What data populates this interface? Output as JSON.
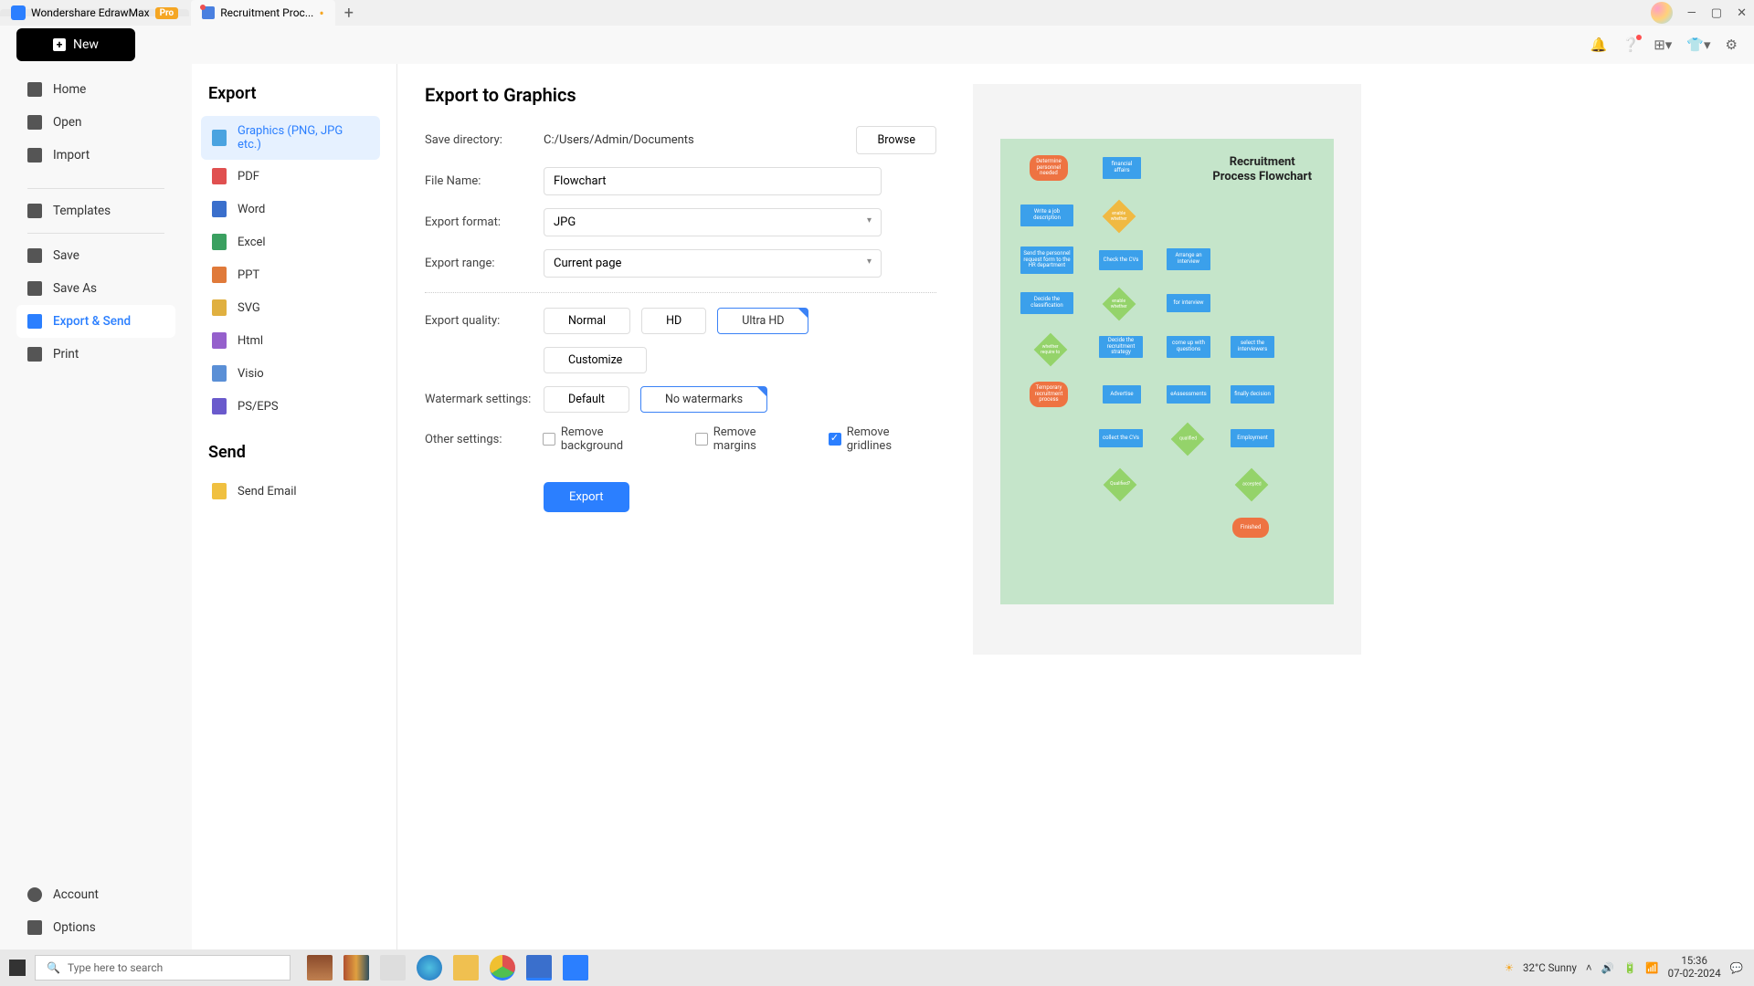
{
  "title_bar": {
    "app_name": "Wondershare EdrawMax",
    "badge": "Pro",
    "doc_tab": "Recruitment Proc..."
  },
  "new_btn": "New",
  "sidebar": {
    "items": [
      "Home",
      "Open",
      "Import",
      "Templates",
      "Save",
      "Save As",
      "Export & Send",
      "Print"
    ],
    "bottom": [
      "Account",
      "Options"
    ]
  },
  "export_col": {
    "title_export": "Export",
    "title_send": "Send",
    "formats": [
      "Graphics (PNG, JPG etc.)",
      "PDF",
      "Word",
      "Excel",
      "PPT",
      "SVG",
      "Html",
      "Visio",
      "PS/EPS"
    ],
    "send_email": "Send Email"
  },
  "form": {
    "heading": "Export to Graphics",
    "save_dir_label": "Save directory:",
    "save_dir": "C:/Users/Admin/Documents",
    "browse": "Browse",
    "filename_label": "File Name:",
    "filename": "Flowchart",
    "format_label": "Export format:",
    "format": "JPG",
    "range_label": "Export range:",
    "range": "Current page",
    "quality_label": "Export quality:",
    "quality": {
      "normal": "Normal",
      "hd": "HD",
      "uhd": "Ultra HD"
    },
    "customize": "Customize",
    "watermark_label": "Watermark settings:",
    "watermark": {
      "default": "Default",
      "none": "No watermarks"
    },
    "other_label": "Other settings:",
    "other": {
      "bg": "Remove background",
      "margins": "Remove margins",
      "grid": "Remove gridlines"
    },
    "export_btn": "Export"
  },
  "preview": {
    "title1": "Recruitment",
    "title2": "Process Flowchart"
  },
  "taskbar": {
    "search_placeholder": "Type here to search",
    "weather": "32°C  Sunny",
    "time": "15:36",
    "date": "07-02-2024"
  }
}
